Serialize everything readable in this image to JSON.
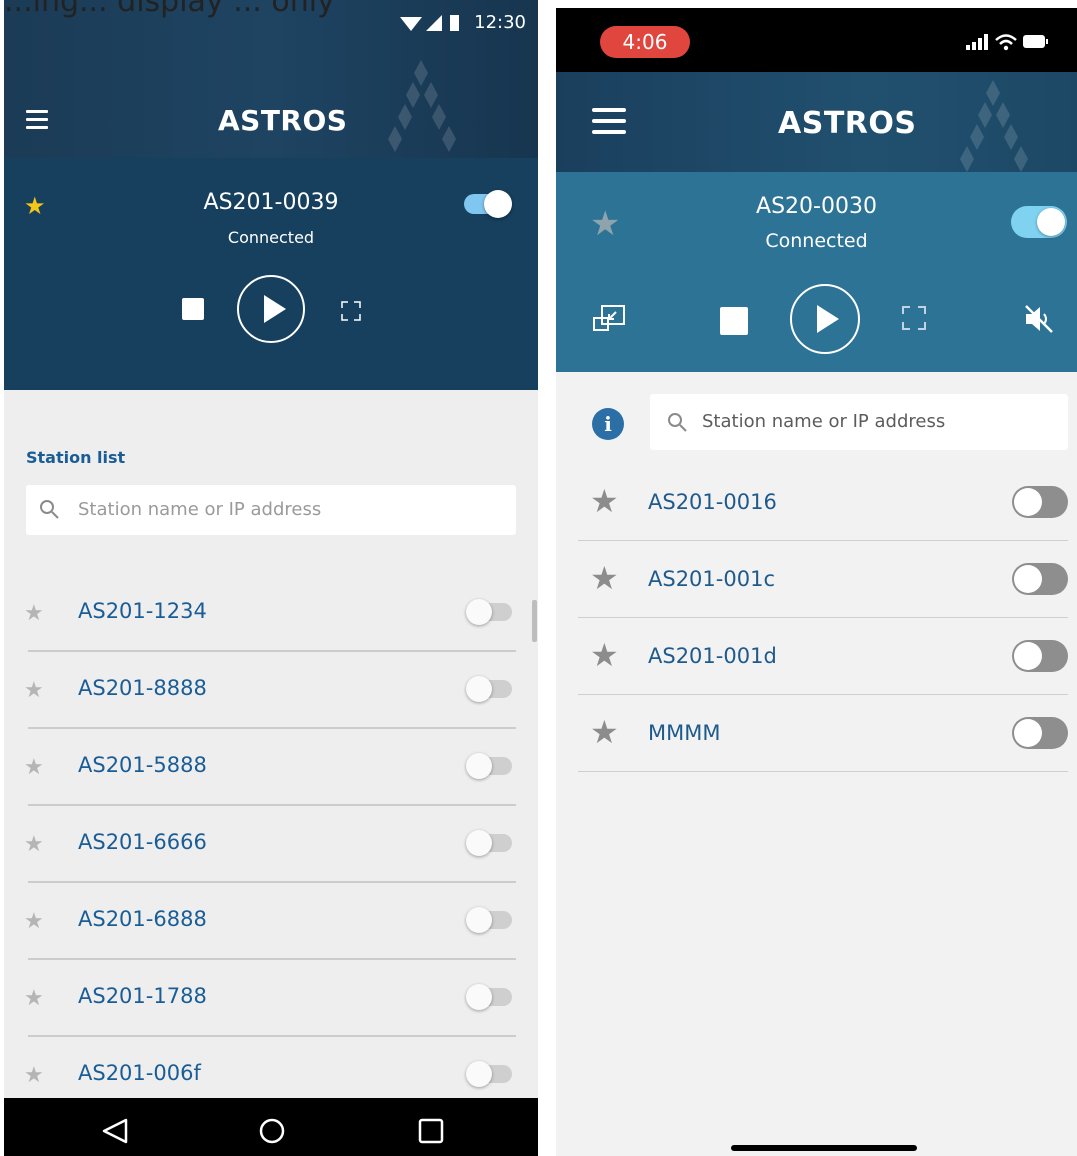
{
  "caption": "...ing... display ... only",
  "android": {
    "status_bar": {
      "time": "12:30"
    },
    "header": {
      "brand": "ASTROS"
    },
    "player": {
      "station": "AS201-0039",
      "status": "Connected",
      "favorite": true,
      "connected_toggle": true
    },
    "station_list": {
      "title": "Station list",
      "search_placeholder": "Station name or IP address",
      "items": [
        {
          "name": "AS201-1234"
        },
        {
          "name": "AS201-8888"
        },
        {
          "name": "AS201-5888"
        },
        {
          "name": "AS201-6666"
        },
        {
          "name": "AS201-6888"
        },
        {
          "name": "AS201-1788"
        },
        {
          "name": "AS201-006f"
        }
      ]
    }
  },
  "ios": {
    "status_bar": {
      "time": "4:06"
    },
    "header": {
      "brand": "ASTROS"
    },
    "player": {
      "station": "AS20-0030",
      "status": "Connected",
      "favorite": false,
      "connected_toggle": true
    },
    "search_placeholder": "Station name or IP address",
    "info_icon": "i",
    "items": [
      {
        "name": "AS201-0016"
      },
      {
        "name": "AS201-001c"
      },
      {
        "name": "AS201-001d"
      },
      {
        "name": "MMMM"
      }
    ]
  },
  "colors": {
    "android_header": "#1b3b56",
    "android_player": "#16405e",
    "ios_player": "#2c7396",
    "link_blue": "#1a5d96",
    "favorite_gold": "#f5c518",
    "toggle_on": "#7fc6f0"
  }
}
